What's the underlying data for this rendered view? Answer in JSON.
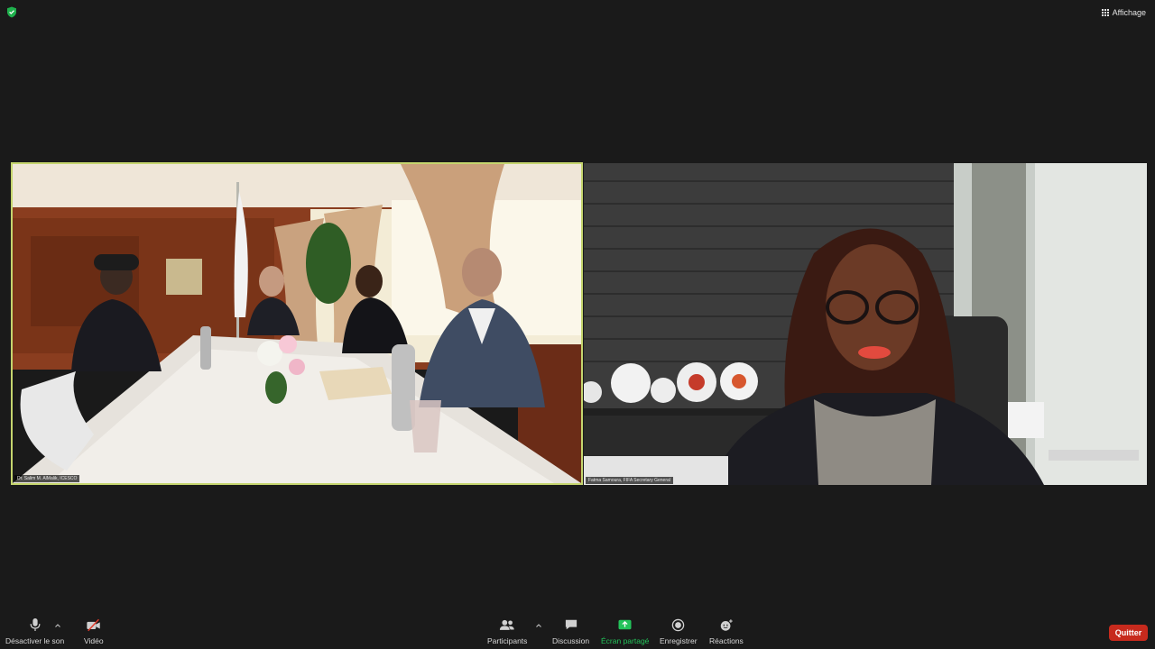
{
  "top": {
    "view_label": "Affichage"
  },
  "tiles": [
    {
      "name": "Dr. Salim M. AlMalik, ICESCO"
    },
    {
      "name": "Fatma Samoura, FIFA Secretary General"
    }
  ],
  "toolbar": {
    "mute_label": "Désactiver le son",
    "video_label": "Vidéo",
    "participants_label": "Participants",
    "chat_label": "Discussion",
    "share_label": "Écran partagé",
    "record_label": "Enregistrer",
    "reactions_label": "Réactions",
    "leave_label": "Quitter"
  },
  "colors": {
    "active_speaker_border": "#c5d56e",
    "share_green": "#23c35a",
    "leave_red": "#c72a1d",
    "shield_green": "#1fb14d"
  }
}
